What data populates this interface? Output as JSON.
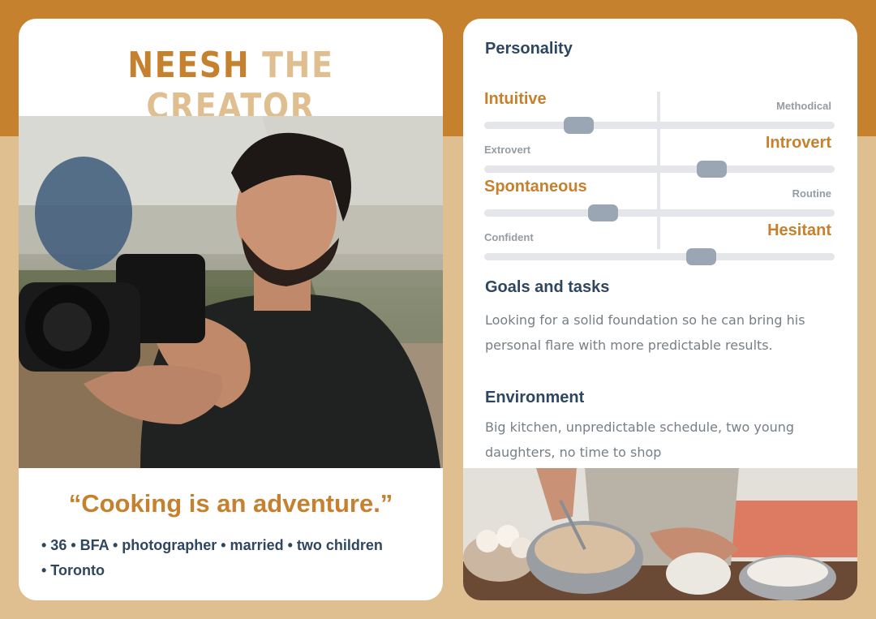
{
  "header": {
    "title_first": "NEESH",
    "title_rest": "THE CREATOR"
  },
  "quote": "“Cooking is an adventure.”",
  "facts": {
    "line1": "• 36 • BFA • photographer • married • two children",
    "line2": "• Toronto"
  },
  "personality": {
    "title": "Personality",
    "sliders": [
      {
        "left": "Intuitive",
        "right": "Methodical",
        "emphasis": "left",
        "value": 0.27
      },
      {
        "left": "Extrovert",
        "right": "Introvert",
        "emphasis": "right",
        "value": 0.65
      },
      {
        "left": "Spontaneous",
        "right": "Routine",
        "emphasis": "left",
        "value": 0.34
      },
      {
        "left": "Confident",
        "right": "Hesitant",
        "emphasis": "right",
        "value": 0.62
      }
    ]
  },
  "goals": {
    "title": "Goals and tasks",
    "text": "Looking for a solid foundation so he can bring his personal flare with more predictable results."
  },
  "environment": {
    "title": "Environment",
    "text": "Big kitchen, unpredictable schedule, two young daughters, no time to shop"
  },
  "colors": {
    "accent": "#c5812d",
    "accent_light": "#dfbe8f",
    "navy": "#2f4660",
    "gray_text": "#777f86",
    "thumb": "#9aa6b4"
  },
  "icons": []
}
